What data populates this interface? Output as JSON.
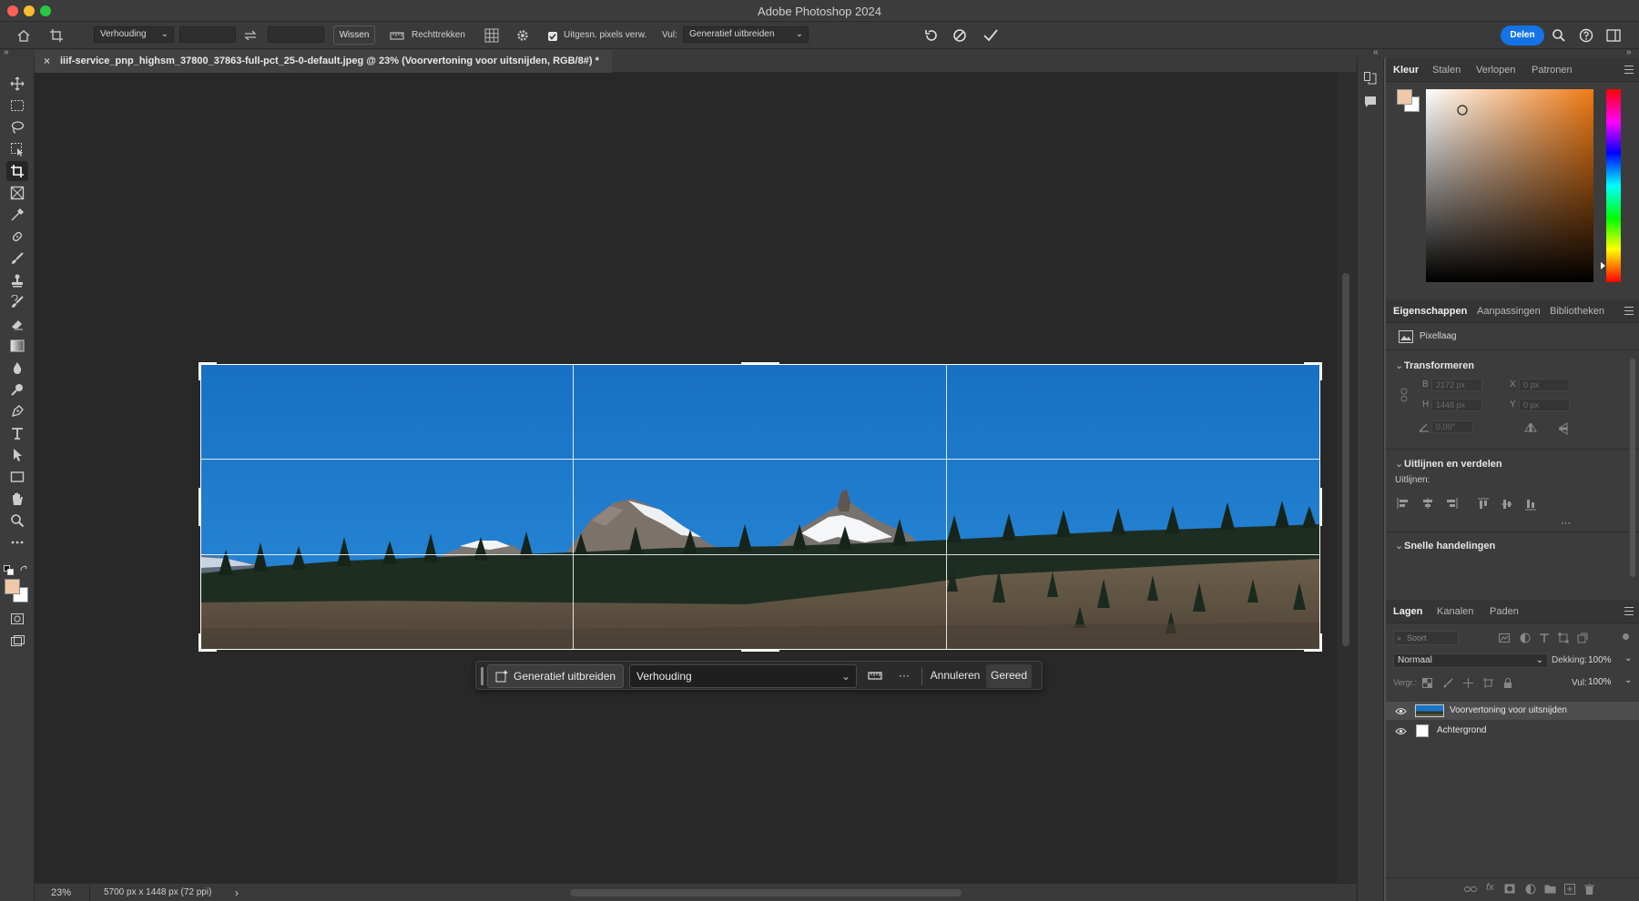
{
  "window": {
    "title": "Adobe Photoshop 2024"
  },
  "options": {
    "ratio_label": "Verhouding",
    "clear_label": "Wissen",
    "straighten_label": "Rechttrekken",
    "delete_cropped_label": "Uitgesn. pixels verw.",
    "fill_label": "Vul:",
    "fill_value": "Generatief uitbreiden",
    "share_label": "Delen"
  },
  "document": {
    "tab_title": "iiif-service_pnp_highsm_37800_37863-full-pct_25-0-default.jpeg @ 23% (Voorvertoning voor uitsnijden, RGB/8#) *",
    "close_glyph": "×",
    "zoom": "23%",
    "doc_info": "5700 px x 1448 px (72 ppi)",
    "status_arrow": "›"
  },
  "context_bar": {
    "generative_expand": "Generatief uitbreiden",
    "ratio_value": "Verhouding",
    "more": "···",
    "cancel": "Annuleren",
    "done": "Gereed"
  },
  "color_panel": {
    "tabs": [
      "Kleur",
      "Stalen",
      "Verlopen",
      "Patronen"
    ],
    "foreground": "#f0c9a8",
    "background": "#ffffff"
  },
  "properties_panel": {
    "tabs": [
      "Eigenschappen",
      "Aanpassingen",
      "Bibliotheken"
    ],
    "layer_type": "Pixellaag",
    "transform_title": "Transformeren",
    "w_label": "B",
    "w_value": "2172 px",
    "h_label": "H",
    "h_value": "1448 px",
    "x_label": "X",
    "x_value": "0 px",
    "y_label": "Y",
    "y_value": "0 px",
    "angle_value": "0,00°",
    "align_title": "Uitlijnen en verdelen",
    "align_label": "Uitlijnen:",
    "more": "···",
    "quick_actions_title": "Snelle handelingen"
  },
  "layers_panel": {
    "tabs": [
      "Lagen",
      "Kanalen",
      "Paden"
    ],
    "search_placeholder": "Soort",
    "blend_mode": "Normaal",
    "opacity_label": "Dekking:",
    "opacity_value": "100%",
    "lock_label": "Vergr.:",
    "fill_label": "Vul:",
    "fill_value": "100%",
    "layers": [
      {
        "name": "Voorvertoning voor uitsnijden",
        "selected": true
      },
      {
        "name": "Achtergrond",
        "selected": false
      }
    ]
  },
  "colors": {
    "accent": "#1473e6",
    "sky": "#1f7fcf"
  }
}
